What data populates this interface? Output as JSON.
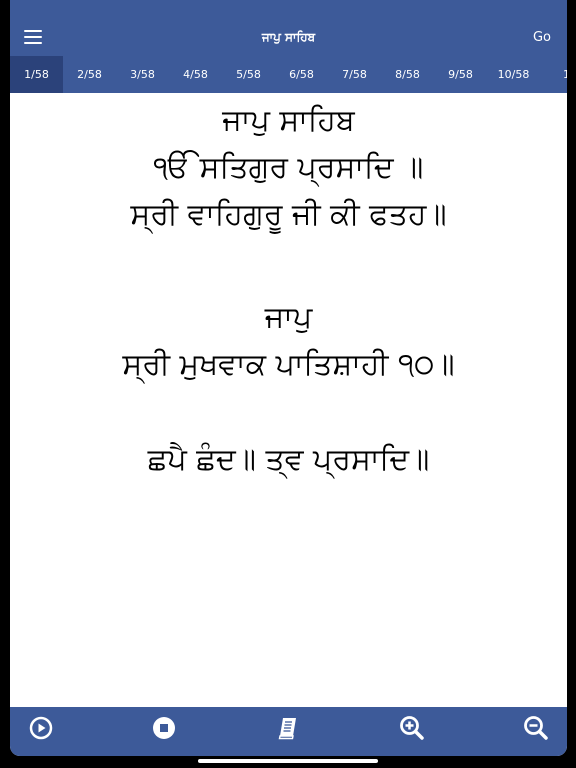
{
  "header": {
    "title": "ਜਾਪੁ ਸਾਹਿਬ",
    "go_label": "Go"
  },
  "tabs": [
    {
      "label": "1/58",
      "active": true
    },
    {
      "label": "2/58"
    },
    {
      "label": "3/58"
    },
    {
      "label": "4/58"
    },
    {
      "label": "5/58"
    },
    {
      "label": "6/58"
    },
    {
      "label": "7/58"
    },
    {
      "label": "8/58"
    },
    {
      "label": "9/58"
    },
    {
      "label": "10/58"
    },
    {
      "label": "1"
    }
  ],
  "content": {
    "lines": [
      "ਜਾਪੁ ਸਾਹਿਬ",
      "ੴ ਸਤਿਗੁਰ ਪ੍ਰਸਾਦਿ ॥",
      "ਸ੍ਰੀ ਵਾਹਿਗੁਰੂ ਜੀ ਕੀ ਫਤਹ॥",
      "",
      "ਜਾਪੁ",
      "ਸ੍ਰੀ ਮੁਖਵਾਕ ਪਾਤਿਸ਼ਾਹੀ ੧੦॥",
      "",
      "ਛਪੈ ਛੰਦ॥ ਤ੍ਵ ਪ੍ਰਸਾਦਿ॥"
    ]
  },
  "bottombar": {
    "icons": [
      "play-icon",
      "stop-icon",
      "book-icon",
      "zoom-in-icon",
      "zoom-out-icon"
    ]
  },
  "colors": {
    "bar": "#3d5a99",
    "active_tab": "#2b427a",
    "text": "#000000"
  }
}
